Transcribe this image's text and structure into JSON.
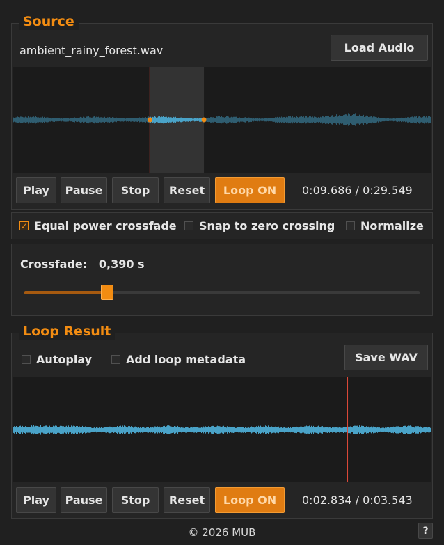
{
  "source": {
    "title": "Source",
    "filename": "ambient_rainy_forest.wav",
    "load_label": "Load Audio",
    "buttons": {
      "play": "Play",
      "pause": "Pause",
      "stop": "Stop",
      "reset": "Reset",
      "loop": "Loop ON"
    },
    "time": "0:09.686 / 0:29.549",
    "position_s": 9.686,
    "duration_s": 29.549,
    "selection_start_s": 9.686,
    "selection_end_s": 13.5
  },
  "options": {
    "equal_power": {
      "label": "Equal power crossfade",
      "checked": true
    },
    "snap_zero": {
      "label": "Snap to zero crossing",
      "checked": false
    },
    "normalize": {
      "label": "Normalize",
      "checked": false
    }
  },
  "crossfade": {
    "label": "Crossfade:",
    "value": "0,390 s",
    "fraction": 0.21
  },
  "result": {
    "title": "Loop Result",
    "autoplay": {
      "label": "Autoplay",
      "checked": false
    },
    "metadata": {
      "label": "Add loop metadata",
      "checked": false
    },
    "save_label": "Save WAV",
    "buttons": {
      "play": "Play",
      "pause": "Pause",
      "stop": "Stop",
      "reset": "Reset",
      "loop": "Loop ON"
    },
    "time": "0:02.834 / 0:03.543",
    "position_s": 2.834,
    "duration_s": 3.543
  },
  "footer": {
    "copyright": "© 2026 MUB",
    "help": "?"
  },
  "colors": {
    "accent": "#f28c12",
    "wave": "#4aa3c8",
    "wave_dim": "#2f5d70",
    "playhead": "#e04a3a"
  }
}
